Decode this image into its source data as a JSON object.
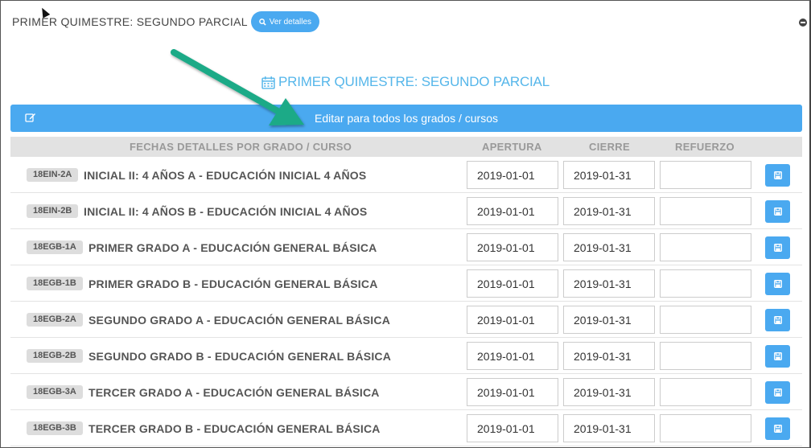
{
  "header": {
    "title": "PRIMER QUIMESTRE: SEGUNDO PARCIAL",
    "details_button": "Ver detalles"
  },
  "panel_title": "PRIMER QUIMESTRE: SEGUNDO PARCIAL",
  "edit_all_label": "Editar para todos los grados / cursos",
  "columns": {
    "course": "FECHAS DETALLES POR GRADO / CURSO",
    "open": "APERTURA",
    "close": "CIERRE",
    "reinforce": "REFUERZO"
  },
  "rows": [
    {
      "code": "18EIN-2A",
      "name": "INICIAL II: 4 AÑOS A - EDUCACIÓN INICIAL 4 AÑOS",
      "apertura": "2019-01-01",
      "cierre": "2019-01-31",
      "refuerzo": ""
    },
    {
      "code": "18EIN-2B",
      "name": "INICIAL II: 4 AÑOS B - EDUCACIÓN INICIAL 4 AÑOS",
      "apertura": "2019-01-01",
      "cierre": "2019-01-31",
      "refuerzo": ""
    },
    {
      "code": "18EGB-1A",
      "name": "PRIMER GRADO A - EDUCACIÓN GENERAL BÁSICA",
      "apertura": "2019-01-01",
      "cierre": "2019-01-31",
      "refuerzo": ""
    },
    {
      "code": "18EGB-1B",
      "name": "PRIMER GRADO B - EDUCACIÓN GENERAL BÁSICA",
      "apertura": "2019-01-01",
      "cierre": "2019-01-31",
      "refuerzo": ""
    },
    {
      "code": "18EGB-2A",
      "name": "SEGUNDO GRADO A - EDUCACIÓN GENERAL BÁSICA",
      "apertura": "2019-01-01",
      "cierre": "2019-01-31",
      "refuerzo": ""
    },
    {
      "code": "18EGB-2B",
      "name": "SEGUNDO GRADO B - EDUCACIÓN GENERAL BÁSICA",
      "apertura": "2019-01-01",
      "cierre": "2019-01-31",
      "refuerzo": ""
    },
    {
      "code": "18EGB-3A",
      "name": "TERCER GRADO A - EDUCACIÓN GENERAL BÁSICA",
      "apertura": "2019-01-01",
      "cierre": "2019-01-31",
      "refuerzo": ""
    },
    {
      "code": "18EGB-3B",
      "name": "TERCER GRADO B - EDUCACIÓN GENERAL BÁSICA",
      "apertura": "2019-01-01",
      "cierre": "2019-01-31",
      "refuerzo": ""
    }
  ],
  "icons": {
    "details": "search-icon",
    "collapse": "minus-circle-icon",
    "title": "calendar-icon",
    "edit": "edit-icon",
    "save": "save-icon"
  },
  "colors": {
    "accent": "#4aa9f0",
    "title": "#55b6ea",
    "annotation_arrow": "#1aaa87"
  }
}
